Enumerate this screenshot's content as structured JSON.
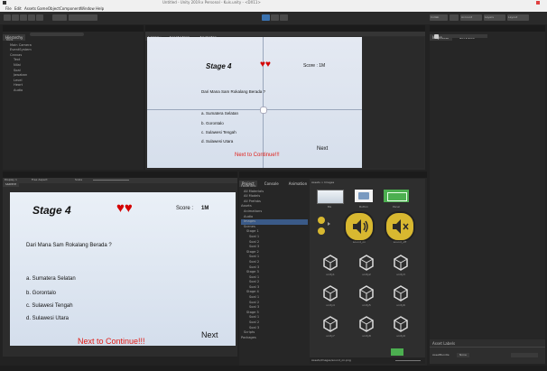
{
  "window": {
    "title": "Untitled - Unity 2019.x Personal - Kuis.unity - <DX11>",
    "menu": [
      "File",
      "Edit",
      "Assets",
      "GameObject",
      "Component",
      "Window",
      "Help"
    ]
  },
  "toolbar": {
    "layers_label": "Layers",
    "layout_label": "Layout",
    "account_label": "Account",
    "collab_label": "Collab"
  },
  "hierarchy": {
    "tab": "Hierarchy",
    "items": [
      "Kuis",
      "Main Camera",
      "EventSystem",
      "Canvas",
      "",
      "",
      "",
      "",
      "",
      "Text",
      "Nilai",
      "Soal",
      "Jawaban",
      "Level",
      "Heart",
      "Audio"
    ]
  },
  "scene": {
    "tabs": [
      "Scene",
      "Asset Store",
      "Animator"
    ],
    "stage": "Stage 4",
    "score": "Score : 1M",
    "question": "Dari Mana Sam Rokalang Berada ?",
    "options": [
      "a. Sumatera Selatan",
      "b. Gorontalo",
      "c. Sulawesi Tengah",
      "d. Sulawesi Utara"
    ],
    "next": "Next",
    "continue": "Next to Continue!!!"
  },
  "game": {
    "tab": "Game",
    "display": "Display 1",
    "resolution": "Free Aspect",
    "scale": "Scale",
    "stage": "Stage 4",
    "score_label": "Score :",
    "score_value": "1M",
    "question": "Dari Mana Sam Rokalang Berada ?",
    "options": [
      "a. Sumatera Selatan",
      "b. Gorontalo",
      "c. Sulawesi Tengah",
      "d. Sulawesi Utara"
    ],
    "next": "Next",
    "continue": "Next to Continue!!!",
    "heart_color": "#d40000",
    "continue_color": "#e0201a"
  },
  "project": {
    "tabs": [
      "Project",
      "Console",
      "Animation"
    ],
    "tree": [
      "Favorites",
      "All Materials",
      "All Models",
      "All Prefabs",
      "Assets",
      "Animations",
      "Audio",
      "Images",
      "Scenes",
      "Stage 1",
      "Soal 1",
      "Soal 2",
      "Soal 3",
      "Stage 2",
      "Soal 1",
      "Soal 2",
      "Soal 3",
      "Stage 3",
      "Soal 1",
      "Soal 2",
      "Soal 3",
      "Stage 4",
      "Soal 1",
      "Soal 2",
      "Soal 3",
      "Stage 5",
      "Soal 1",
      "Soal 2",
      "Soal 3",
      "Scripts",
      "Packages"
    ],
    "path": "Assets > Images",
    "assets": [
      "BG",
      "Button",
      "Panel",
      "",
      "sound_on",
      "sound_off",
      "unity1",
      "unity2",
      "unity3",
      "unity4",
      "unity5",
      "unity6",
      "unity7",
      "unity8",
      "unity9"
    ],
    "footer": "Assets/Images/sound_on.png"
  },
  "inspector": {
    "tabs": [
      "Inspector",
      "Services"
    ],
    "asset_labels_title": "Asset Labels",
    "asset_bundle_label": "AssetBundle",
    "asset_bundle_value": "None"
  },
  "colors": {
    "accent": "#3a72b0",
    "sound_button": "#d8b830",
    "green": "#4caf50"
  }
}
